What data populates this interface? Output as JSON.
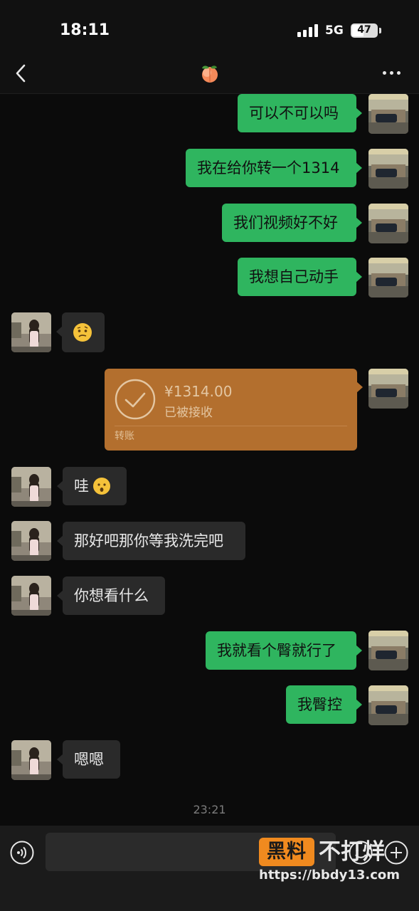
{
  "status_bar": {
    "time": "18:11",
    "network": "5G",
    "battery": "47",
    "battery_level": 0.47
  },
  "header": {
    "title_icon": "peach-emoji",
    "back_icon": "chevron-left-icon",
    "more_icon": "ellipsis-icon"
  },
  "messages": [
    {
      "direction": "out",
      "text": "可以不可以吗"
    },
    {
      "direction": "out",
      "text": "我在给你转一个1314"
    },
    {
      "direction": "out",
      "text": "我们视频好不好"
    },
    {
      "direction": "out",
      "text": "我想自己动手"
    },
    {
      "direction": "in",
      "emoji": "confused-face-emoji"
    },
    {
      "direction": "out",
      "type": "transfer",
      "amount": "¥1314.00",
      "status": "已被接收",
      "label": "转账"
    },
    {
      "direction": "in",
      "text": "哇",
      "emoji": "hushed-face-emoji"
    },
    {
      "direction": "in",
      "text": "那好吧那你等我洗完吧"
    },
    {
      "direction": "in",
      "text": "你想看什么"
    },
    {
      "direction": "out",
      "text": "我就看个臀就行了"
    },
    {
      "direction": "out",
      "text": "我臀控"
    },
    {
      "direction": "in",
      "text": "嗯嗯"
    }
  ],
  "timestamp": "23:21",
  "input": {
    "value": "",
    "voice_icon": "voice-icon",
    "emoji_icon": "emoji-icon",
    "plus_icon": "plus-icon"
  },
  "watermark": {
    "badge": "黑料",
    "text": "不打烊",
    "url": "https://bbdy13.com"
  },
  "colors": {
    "outgoing_bubble": "#2fb55f",
    "incoming_bubble": "#2a2a2a",
    "transfer_card": "#b36f2e",
    "background": "#0b0b0b"
  }
}
